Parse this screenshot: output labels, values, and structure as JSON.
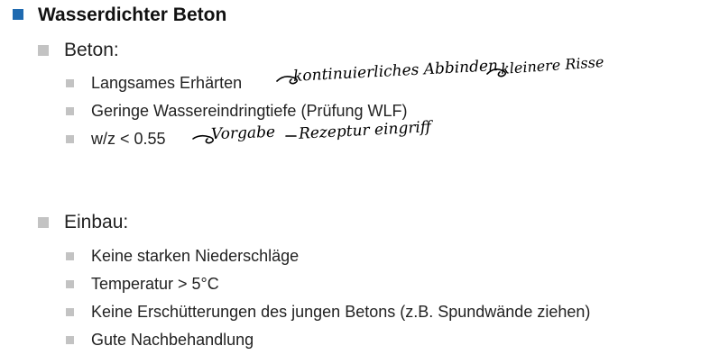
{
  "slide": {
    "title": "Wasserdichter Beton",
    "sections": [
      {
        "heading": "Beton:",
        "items": [
          {
            "text": "Langsames Erhärten",
            "note": "kontinuierliches Abbinden",
            "note2": "kleinere Risse"
          },
          {
            "text": "Geringe Wassereindringtiefe (Prüfung WLF)"
          },
          {
            "text": "w/z < 0.55",
            "note": "Vorgabe",
            "note2": "Rezeptur eingriff"
          }
        ]
      },
      {
        "heading": "Einbau:",
        "items": [
          {
            "text": "Keine starken Niederschläge"
          },
          {
            "text": "Temperatur > 5°C"
          },
          {
            "text": "Keine Erschütterungen des jungen Betons (z.B. Spundwände ziehen)"
          },
          {
            "text": "Gute Nachbehandlung"
          }
        ]
      }
    ]
  },
  "colors": {
    "title_bullet": "#1f6ab0",
    "sub_bullet": "#c3c3c3"
  }
}
